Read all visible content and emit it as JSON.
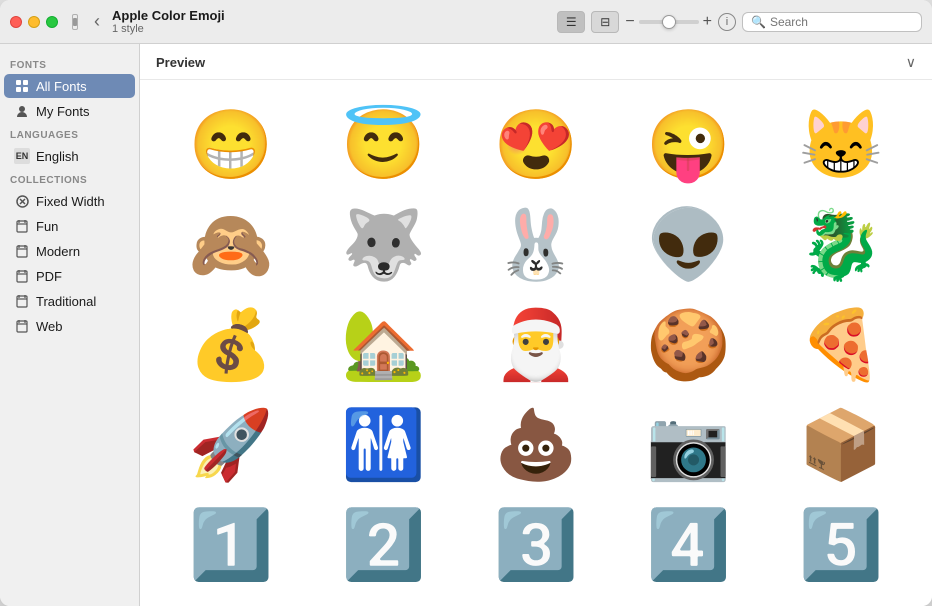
{
  "window": {
    "title": "Apple Color Emoji",
    "subtitle": "1 style"
  },
  "traffic_lights": {
    "red_label": "close",
    "yellow_label": "minimize",
    "green_label": "maximize"
  },
  "toolbar": {
    "back_label": "‹",
    "list_view_label": "≡",
    "grid_view_label": "⊟",
    "size_minus": "−",
    "size_plus": "+",
    "info_label": "i",
    "search_placeholder": "Search"
  },
  "sidebar": {
    "fonts_section": "Fonts",
    "fonts_items": [
      {
        "id": "all-fonts",
        "label": "All Fonts",
        "icon": "grid",
        "active": true
      },
      {
        "id": "my-fonts",
        "label": "My Fonts",
        "icon": "person"
      }
    ],
    "languages_section": "Languages",
    "languages_items": [
      {
        "id": "english",
        "label": "English",
        "icon": "en-badge"
      }
    ],
    "collections_section": "Collections",
    "collections_items": [
      {
        "id": "fixed-width",
        "label": "Fixed Width",
        "icon": "gear"
      },
      {
        "id": "fun",
        "label": "Fun",
        "icon": "doc"
      },
      {
        "id": "modern",
        "label": "Modern",
        "icon": "doc"
      },
      {
        "id": "pdf",
        "label": "PDF",
        "icon": "doc"
      },
      {
        "id": "traditional",
        "label": "Traditional",
        "icon": "doc"
      },
      {
        "id": "web",
        "label": "Web",
        "icon": "doc"
      }
    ]
  },
  "preview": {
    "label": "Preview",
    "emojis": [
      "😁",
      "😇",
      "😍",
      "😜",
      "😸",
      "🙈",
      "🐺",
      "🐰",
      "👽",
      "🐉",
      "💰",
      "🏡",
      "🎅",
      "🍪",
      "🍕",
      "🚀",
      "🚻",
      "💩",
      "📷",
      "📦",
      "1️⃣",
      "2️⃣",
      "3️⃣",
      "4️⃣",
      "5️⃣"
    ]
  }
}
